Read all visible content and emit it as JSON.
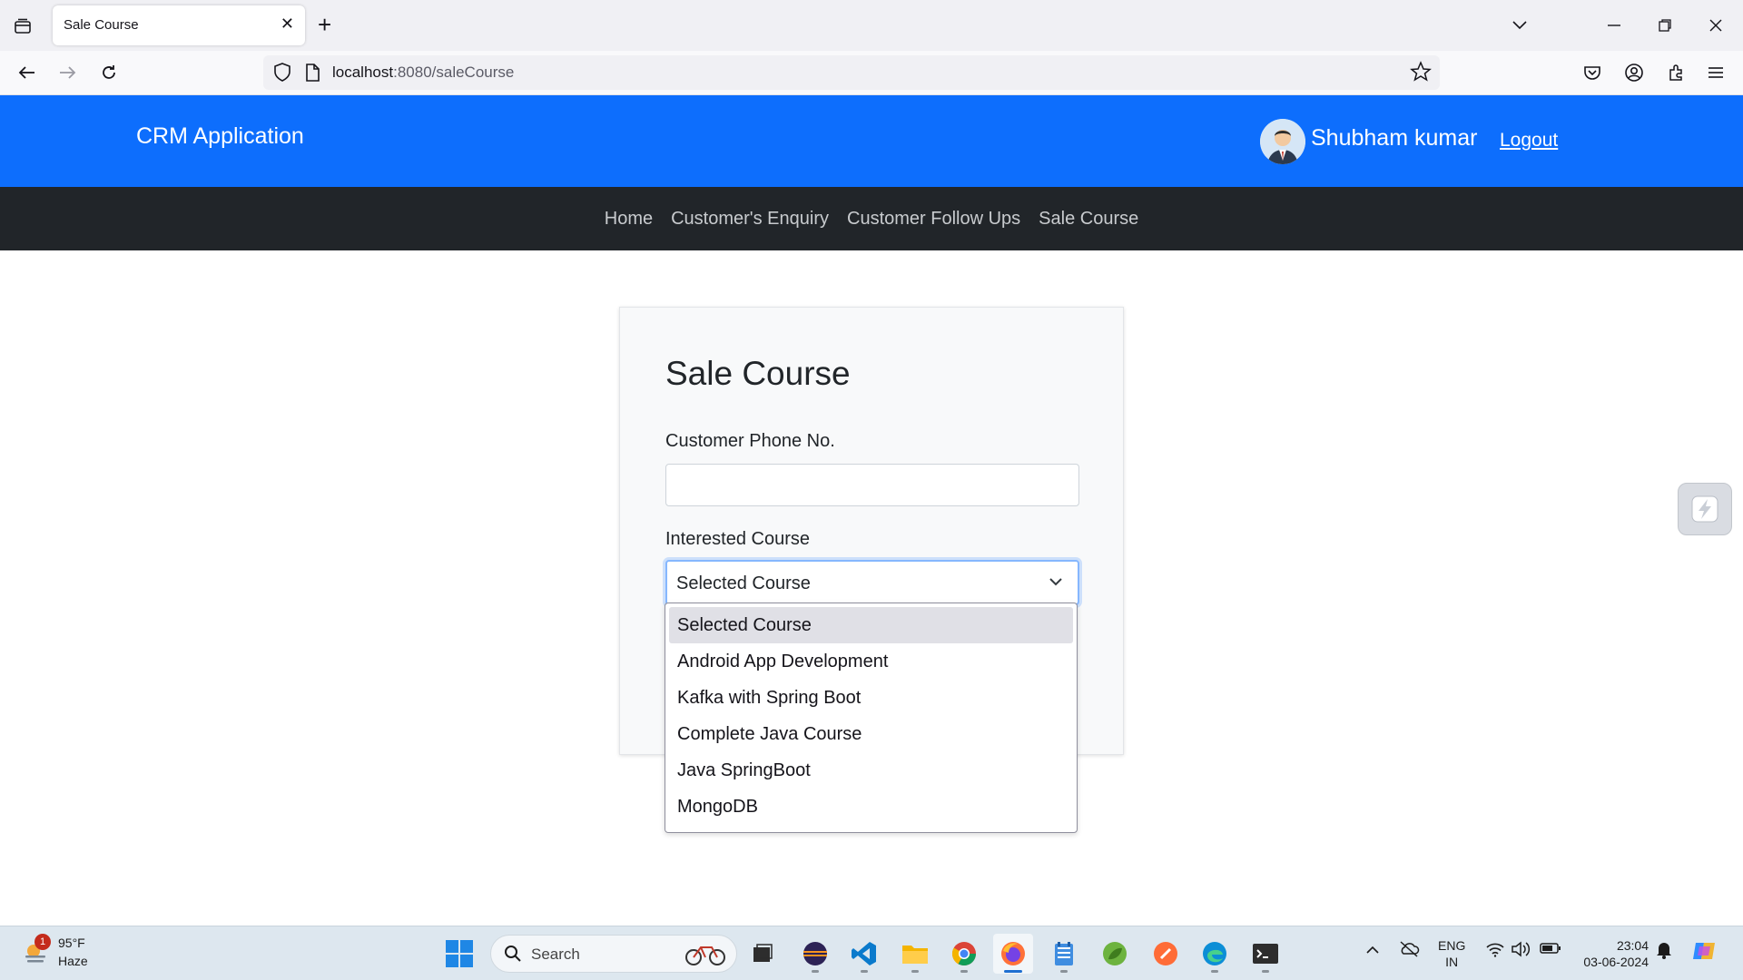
{
  "browser": {
    "tab_title": "Sale Course",
    "url_host": "localhost",
    "url_path": ":8080/saleCourse"
  },
  "header": {
    "brand": "CRM Application",
    "user_name": "Shubham kumar",
    "logout": "Logout"
  },
  "nav": {
    "items": [
      "Home",
      "Customer's Enquiry",
      "Customer Follow Ups",
      "Sale Course"
    ]
  },
  "form": {
    "title": "Sale Course",
    "phone_label": "Customer Phone No.",
    "phone_value": "",
    "course_label": "Interested Course",
    "course_selected": "Selected Course",
    "course_options": [
      "Selected Course",
      "Android App Development",
      "Kafka with Spring Boot",
      "Complete Java Course",
      "Java SpringBoot",
      "MongoDB"
    ]
  },
  "taskbar": {
    "weather_badge": "1",
    "weather_temp": "95°F",
    "weather_cond": "Haze",
    "search_label": "Search",
    "lang_top": "ENG",
    "lang_bottom": "IN",
    "time": "23:04",
    "date": "03-06-2024"
  },
  "colors": {
    "primary": "#0d6efd",
    "navbar_dark": "#212529",
    "focus_border": "#86b7fe"
  }
}
